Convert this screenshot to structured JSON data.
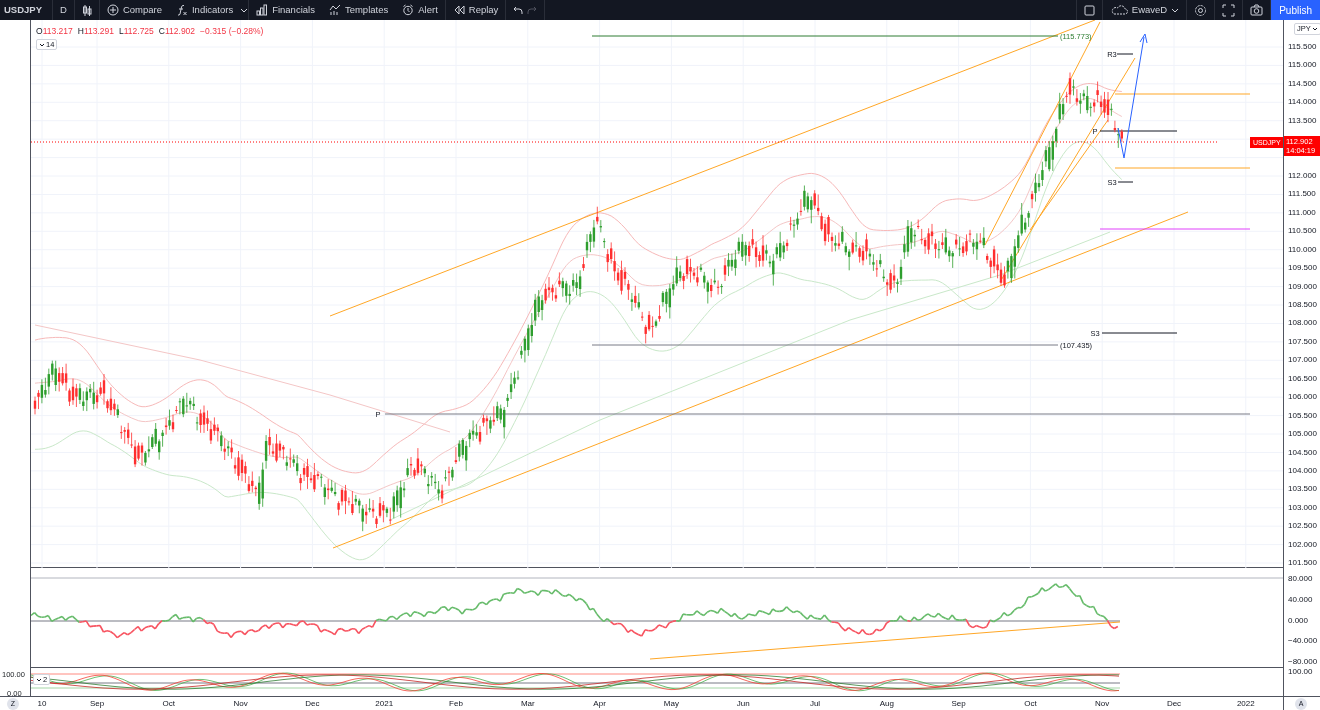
{
  "toolbar": {
    "symbol": "USDJPY",
    "interval": "D",
    "tools": [
      {
        "label": "Compare"
      },
      {
        "label": "Indicators"
      },
      {
        "label": "Financials"
      },
      {
        "label": "Templates"
      },
      {
        "label": "Alert"
      },
      {
        "label": "Replay"
      }
    ],
    "layout_name": "EwaveD",
    "publish_button": "Publish"
  },
  "legend": {
    "values": [
      {
        "key": "O",
        "value": "113.217"
      },
      {
        "key": "H",
        "value": "113.291"
      },
      {
        "key": "L",
        "value": "112.725"
      },
      {
        "key": "C",
        "value": "112.902"
      }
    ],
    "change": "−0.315 (−0.28%)",
    "indicator_count": "14"
  },
  "price_axis": {
    "currency": "JPY",
    "labels": [
      "115.500",
      "115.000",
      "114.500",
      "114.000",
      "113.500",
      "112.000",
      "111.500",
      "111.000",
      "110.500",
      "110.000",
      "109.500",
      "109.000",
      "108.500",
      "108.000",
      "107.500",
      "107.000",
      "106.500",
      "106.000",
      "105.500",
      "105.000",
      "104.500",
      "104.000",
      "103.500",
      "103.000",
      "102.500",
      "102.000",
      "101.500"
    ]
  },
  "last_price": {
    "symbol": "USDJPY",
    "price": "112.902",
    "countdown": "14:04:19"
  },
  "levels": {
    "high": "(115.773)",
    "low": "(107.435)"
  },
  "pivot_labels": [
    "R3",
    "P",
    "S3",
    "S3",
    "P"
  ],
  "oscillator": {
    "axis_labels": [
      "80.000",
      "40.000",
      "0.000",
      "−40.000",
      "−80.000"
    ]
  },
  "stochastic": {
    "left_labels": [
      "100.00",
      "0.00"
    ],
    "right_label": "100.00",
    "indicator_count": "2"
  },
  "time_axis": {
    "left_button": "Z",
    "labels": [
      "10",
      "Sep",
      "Oct",
      "Nov",
      "Dec",
      "2021",
      "Feb",
      "Mar",
      "Apr",
      "May",
      "Jun",
      "Jul",
      "Aug",
      "Sep",
      "Oct",
      "Nov",
      "Dec",
      "2022"
    ],
    "right_button": "A"
  }
}
